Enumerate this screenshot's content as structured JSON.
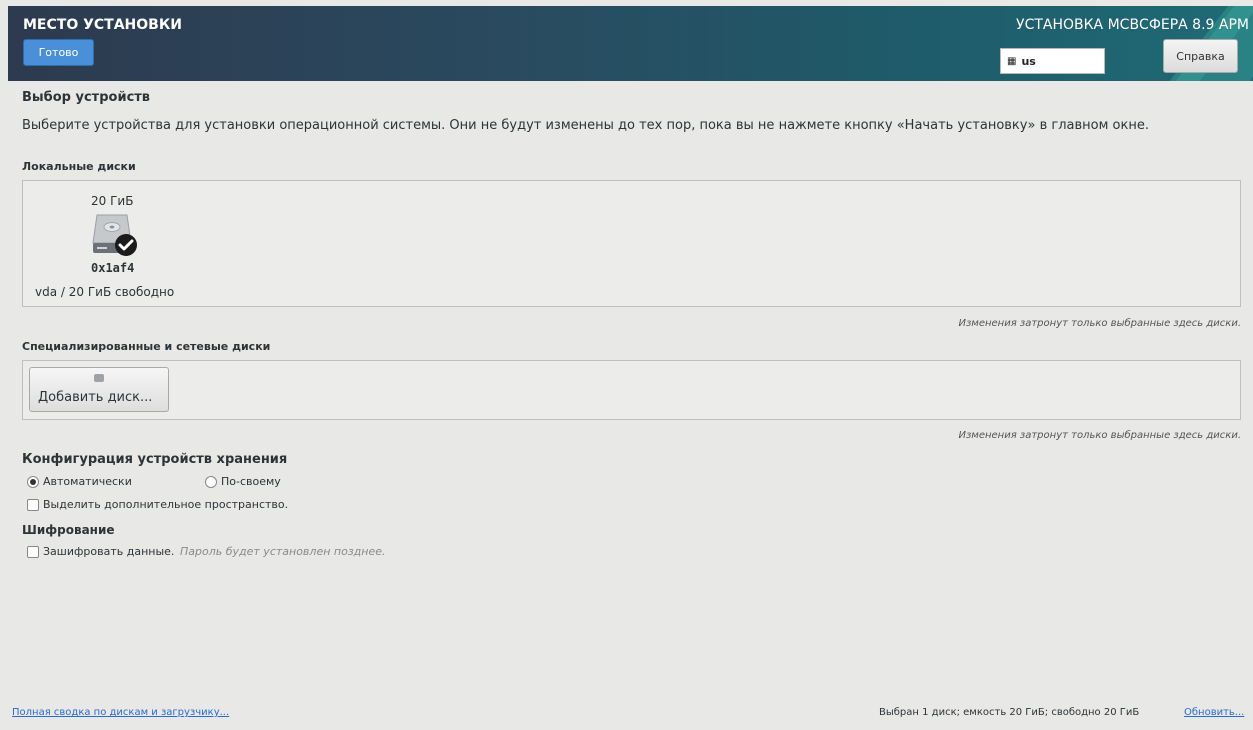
{
  "header": {
    "title": "МЕСТО УСТАНОВКИ",
    "done_label": "Готово",
    "product_title": "УСТАНОВКА МСВСФЕРА 8.9 АРМ",
    "keyboard_layout": "us",
    "help_label": "Справка"
  },
  "device_selection": {
    "title": "Выбор устройств",
    "description": "Выберите устройства для установки операционной системы. Они не будут изменены до тех пор, пока вы не нажмете кнопку «Начать установку» в главном окне."
  },
  "local_disks": {
    "label": "Локальные диски",
    "disks": [
      {
        "capacity": "20 ГиБ",
        "name": "0x1af4",
        "info": "vda  /  20 ГиБ свободно",
        "selected": true
      }
    ],
    "note": "Изменения затронут только выбранные здесь диски."
  },
  "specialized_disks": {
    "label": "Специализированные и сетевые диски",
    "add_label": "Добавить диск...",
    "note": "Изменения затронут только выбранные здесь диски."
  },
  "storage_config": {
    "title": "Конфигурация устройств хранения",
    "auto_label": "Автоматически",
    "custom_label": "По-своему",
    "reclaim_label": "Выделить дополнительное пространство.",
    "selected": "auto"
  },
  "encryption": {
    "title": "Шифрование",
    "encrypt_label": "Зашифровать данные.",
    "encrypt_hint": "Пароль будет установлен позднее."
  },
  "footer": {
    "summary_link": "Полная сводка по дискам и загрузчику...",
    "status": "Выбран 1 диск; емкость 20 ГиБ; свободно 20 ГиБ",
    "refresh_link": "Обновить..."
  },
  "colors": {
    "accent": "#4a90d9",
    "link": "#2a6ad3",
    "header_start": "#2d3a4f",
    "header_end": "#1f6a76"
  }
}
